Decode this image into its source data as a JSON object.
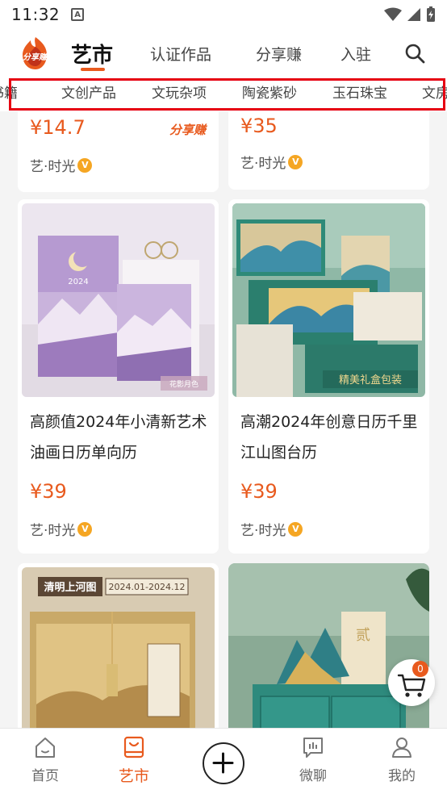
{
  "status": {
    "time": "11:32",
    "a_label": "A"
  },
  "header": {
    "logo_text": "分享赚",
    "tabs": [
      {
        "label": "艺市",
        "active": true
      },
      {
        "label": "认证作品"
      },
      {
        "label": "分享赚"
      },
      {
        "label": "入驻"
      }
    ],
    "search_icon": "search-icon"
  },
  "categories": [
    "书籍",
    "文创产品",
    "文玩杂项",
    "陶瓷紫砂",
    "玉石珠宝",
    "文房"
  ],
  "products": [
    {
      "price": "¥14.7",
      "seller": "艺·时光",
      "tag": "分享赚"
    },
    {
      "price": "¥35",
      "seller": "艺·时光"
    },
    {
      "title": "高颜值2024年小清新艺术油画日历单向历",
      "price": "¥39",
      "seller": "艺·时光",
      "img_caption": "2024",
      "img_tag": "花影月色"
    },
    {
      "title": "高潮2024年创意日历千里江山图台历",
      "price": "¥39",
      "seller": "艺·时光",
      "img_caption": "精美礼盒包装"
    },
    {
      "img_caption": "清明上河图",
      "img_date": "2024.01-2024.12"
    },
    {
      "img_caption": "贰"
    }
  ],
  "cart": {
    "count": "0"
  },
  "bottom_nav": [
    {
      "label": "首页",
      "icon": "home-icon"
    },
    {
      "label": "艺市",
      "icon": "market-icon",
      "active": true
    },
    {
      "label": "",
      "icon": "plus-icon"
    },
    {
      "label": "微聊",
      "icon": "chat-icon"
    },
    {
      "label": "我的",
      "icon": "profile-icon"
    }
  ],
  "colors": {
    "accent": "#e85a1e",
    "highlight": "#e60012",
    "badge": "#f5a623"
  }
}
